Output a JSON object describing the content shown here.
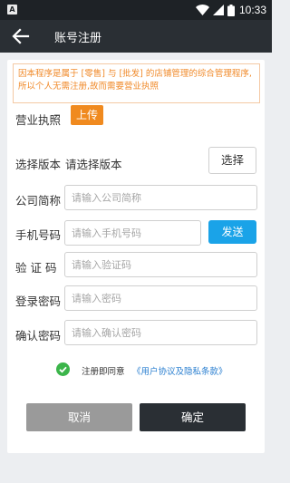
{
  "status_bar": {
    "app_badge": "A",
    "time": "10:33",
    "icons": [
      "wifi-icon",
      "signal-icon",
      "battery-icon"
    ]
  },
  "app_bar": {
    "back_icon": "back-arrow-icon",
    "title": "账号注册"
  },
  "notice": {
    "text": "因本程序是属于 [零售] 与 [批发] 的店铺管理的综合管理程序,所以个人无需注册,故而需要营业执照"
  },
  "form": {
    "license": {
      "label": "营业执照",
      "button": "上传"
    },
    "version": {
      "label": "选择版本",
      "value": "请选择版本",
      "button": "选择"
    },
    "company": {
      "label": "公司简称",
      "value": "",
      "placeholder": "请输入公司简称"
    },
    "phone": {
      "label": "手机号码",
      "value": "",
      "placeholder": "请输入手机号码",
      "button": "发送"
    },
    "code": {
      "label": "验 证 码",
      "value": "",
      "placeholder": "请输入验证码"
    },
    "password": {
      "label": "登录密码",
      "value": "",
      "placeholder": "请输入密码"
    },
    "confirm_password": {
      "label": "确认密码",
      "value": "",
      "placeholder": "请输入确认密码"
    }
  },
  "agreement": {
    "icon": "check-circle-icon",
    "text": "注册即同意",
    "link": "《用户协议及隐私条款》"
  },
  "actions": {
    "cancel": "取消",
    "confirm": "确定"
  },
  "colors": {
    "accent_orange": "#f08a1f",
    "send_blue": "#1aa3e8",
    "link_blue": "#2a7fd0",
    "check_green": "#3bb54a",
    "appbar_dark": "#2a2f34",
    "cancel_gray": "#9a9a9a"
  }
}
